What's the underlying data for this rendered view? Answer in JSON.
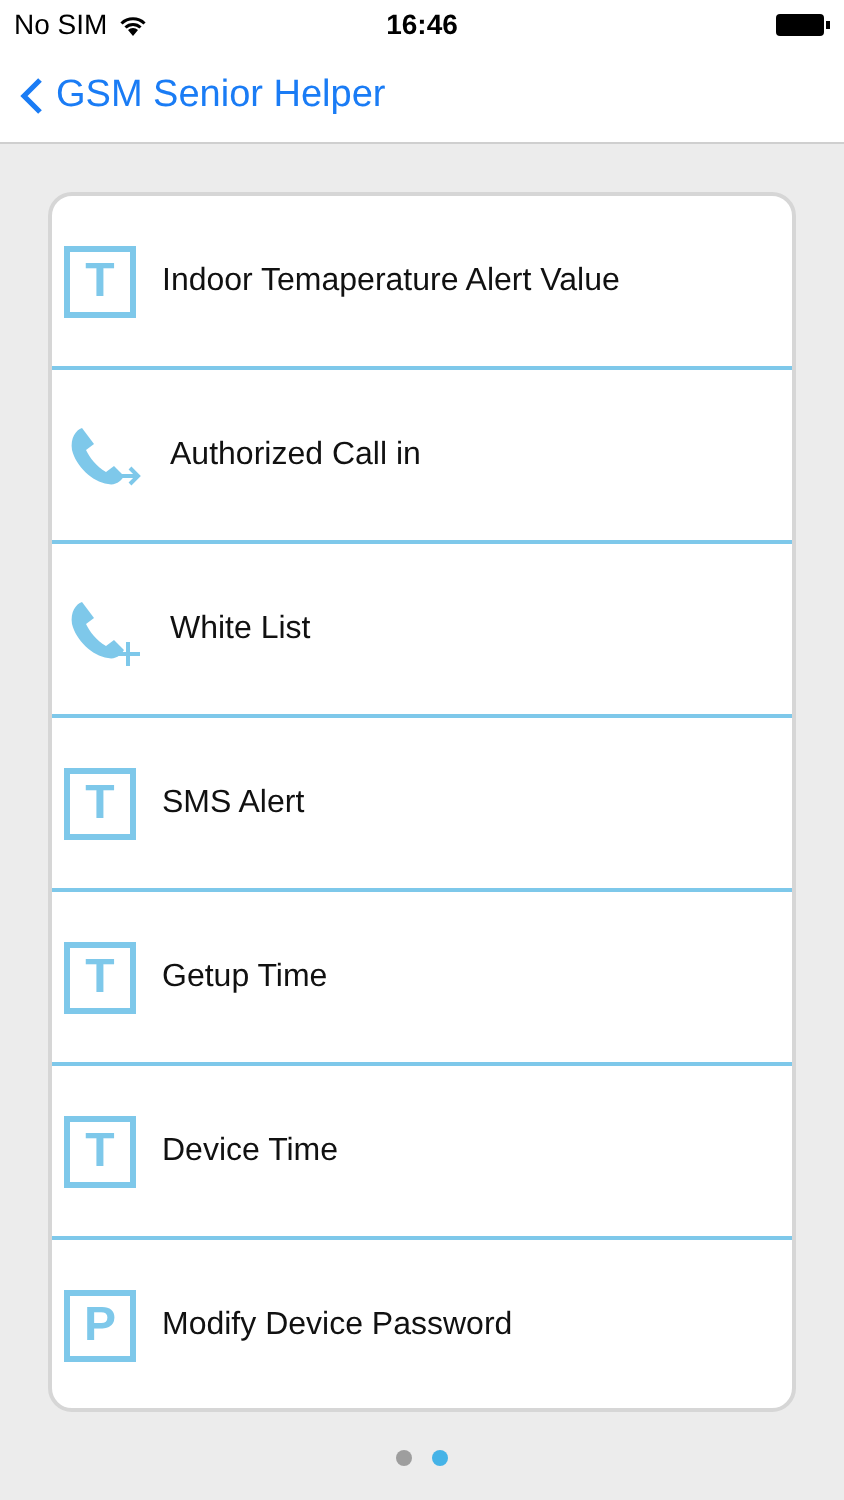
{
  "status_bar": {
    "carrier": "No SIM",
    "time": "16:46"
  },
  "nav": {
    "back_label": "GSM Senior Helper"
  },
  "items": [
    {
      "label": "Indoor Temaperature Alert Value",
      "kind": "letter",
      "glyph": "T"
    },
    {
      "label": "Authorized Call in",
      "kind": "call-forward"
    },
    {
      "label": "White List",
      "kind": "call-add"
    },
    {
      "label": "SMS Alert",
      "kind": "letter",
      "glyph": "T"
    },
    {
      "label": "Getup Time",
      "kind": "letter",
      "glyph": "T"
    },
    {
      "label": "Device Time",
      "kind": "letter",
      "glyph": "T"
    },
    {
      "label": "Modify Device Password",
      "kind": "letter",
      "glyph": "P"
    }
  ],
  "page_dots": [
    {
      "selected": false
    },
    {
      "selected": true
    }
  ]
}
